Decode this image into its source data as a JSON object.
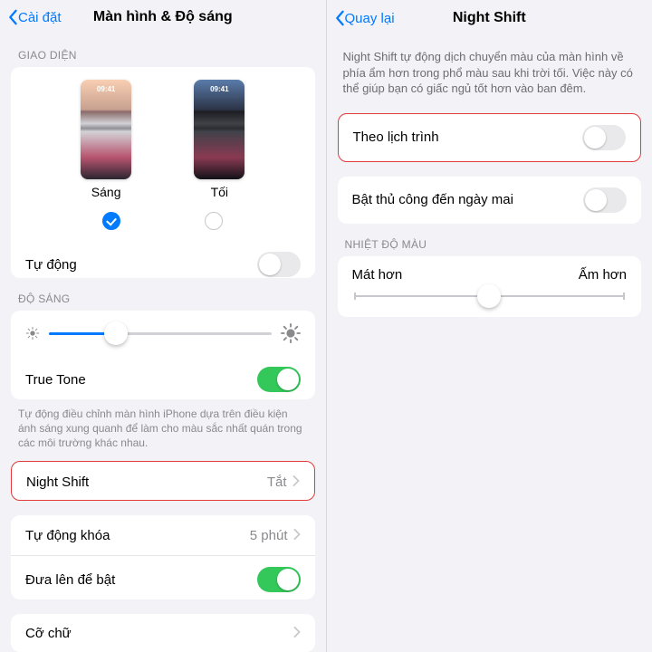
{
  "left": {
    "nav": {
      "back": "Cài đặt",
      "title": "Màn hình & Độ sáng"
    },
    "sections": {
      "appearance_header": "GIAO DIỆN",
      "light_label": "Sáng",
      "dark_label": "Tối",
      "clock": "09:41",
      "auto_label": "Tự động",
      "brightness_header": "ĐỘ SÁNG",
      "truetone_label": "True Tone",
      "truetone_note": "Tự động điều chỉnh màn hình iPhone dựa trên điều kiện ánh sáng xung quanh để làm cho màu sắc nhất quán trong các môi trường khác nhau.",
      "nightshift_label": "Night Shift",
      "nightshift_value": "Tắt",
      "autolock_label": "Tự động khóa",
      "autolock_value": "5 phút",
      "raise_label": "Đưa lên để bật",
      "textsize_label": "Cỡ chữ"
    },
    "brightness_percent": 30
  },
  "right": {
    "nav": {
      "back": "Quay lại",
      "title": "Night Shift"
    },
    "description": "Night Shift tự động dịch chuyển màu của màn hình về phía ẩm hơn trong phổ màu sau khi trời tối. Việc này có thể giúp bạn có giấc ngủ tốt hơn vào ban đêm.",
    "schedule_label": "Theo lịch trình",
    "manual_label": "Bật thủ công đến ngày mai",
    "temp_header": "NHIỆT ĐỘ MÀU",
    "temp_cool": "Mát hơn",
    "temp_warm": "Ấm hơn",
    "temp_percent": 50
  }
}
